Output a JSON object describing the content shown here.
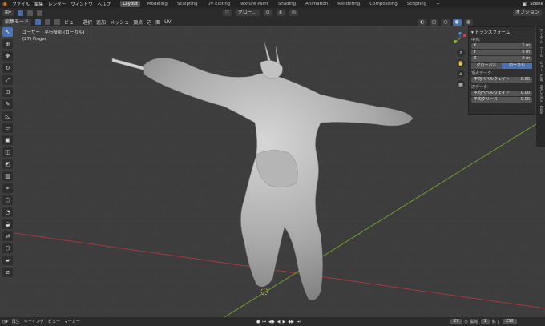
{
  "topbar": {
    "menus": [
      "ファイル",
      "編集",
      "レンダー",
      "ウィンドウ",
      "ヘルプ"
    ],
    "workspaces": [
      "Layout",
      "Modeling",
      "Sculpting",
      "UV Editing",
      "Texture Paint",
      "Shading",
      "Animation",
      "Rendering",
      "Compositing",
      "Scripting"
    ],
    "active_workspace": "Layout",
    "add_tab": "+",
    "scene": "Scene"
  },
  "header": {
    "mode": "編集モード",
    "menus": [
      "ビュー",
      "選択",
      "追加",
      "メッシュ",
      "頂点",
      "辺",
      "面",
      "UV"
    ],
    "transform_orientation": "グロー...",
    "options": "オプション"
  },
  "viewport": {
    "view_name": "ユーザー・平行投影 (ローカル)",
    "object_name": "(27) Finger"
  },
  "n_panel": {
    "header": "トランスフォーム",
    "median_label": "中点:",
    "fields": [
      {
        "axis": "X",
        "value": "1 m"
      },
      {
        "axis": "Y",
        "value": "0 m"
      },
      {
        "axis": "Z",
        "value": "0 m"
      }
    ],
    "global_label": "グローバル",
    "local_label": "ローカル",
    "vertex_data_label": "頂点データ:",
    "vertex_bevel": {
      "label": "平均ベベルウェイト",
      "value": "0.00"
    },
    "edge_data_label": "辺データ:",
    "edge_bevel": {
      "label": "平均ベベルウェイト",
      "value": "0.00"
    },
    "edge_crease": {
      "label": "平均クリース",
      "value": "0.00"
    },
    "side_tabs": [
      "アイテム",
      "ツール",
      "ビュー",
      "Edit",
      "MACHIN3",
      "Tools"
    ]
  },
  "timeline": {
    "playback": "再生",
    "keying": "キーイング",
    "view": "ビュー",
    "marker": "マーカー",
    "current_frame": "27",
    "start_label": "開始",
    "start_frame": "1",
    "end_label": "終了",
    "end_frame": "250"
  },
  "colors": {
    "accent": "#4772b3",
    "viewport_bg": "#3d3d3d",
    "x_axis": "#a33a3a",
    "y_axis": "#6a9b2e",
    "mesh": "#b8b8b8"
  }
}
